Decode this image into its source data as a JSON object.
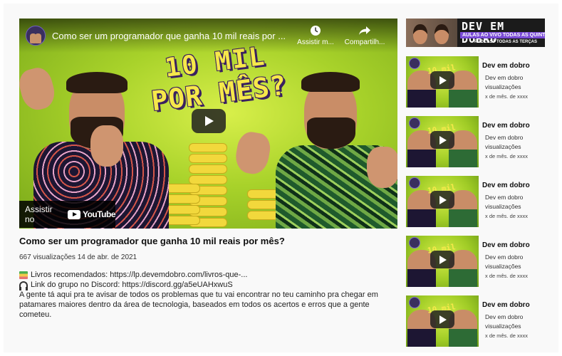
{
  "player": {
    "title": "Como ser um programador que ganha 10 mil reais por ...",
    "watch_later_label": "Assistir m...",
    "share_label": "Compartilh...",
    "thumb_text_line1": "10 MIL",
    "thumb_text_line2": "POR MÊS?",
    "watch_on_label": "Assistir no",
    "youtube_logo_text": "YouTube"
  },
  "video": {
    "title": "Como ser um programador que ganha 10 mil reais por mês?",
    "meta": "667 visualizações 14 de abr. de 2021",
    "desc_books": "Livros recomendados: https://lp.devemdobro.com/livros-que-...",
    "desc_discord": "Link do grupo no Discord: https://discord.gg/a5eUAHxwuS",
    "desc_body": "A gente tá aqui pra te avisar de todos os problemas que tu vai encontrar no teu caminho pra chegar em patamares maiores dentro da área de tecnologia, baseados em todos os acertos e erros que a gente cometeu."
  },
  "banner": {
    "line1": "DEV EM DOBRO",
    "line2": "AULAS AO VIVO TODAS AS QUINTAS",
    "line3": "PODCAST TODAS AS TERÇAS"
  },
  "related": [
    {
      "title": "Dev em dobro",
      "channel": "Dev em dobro",
      "views": "visualizações",
      "date": "x de mês. de xxxx",
      "thumb_text": "10 mil"
    },
    {
      "title": "Dev em dobro",
      "channel": "Dev em dobro",
      "views": "visualizações",
      "date": "x de mês. de xxxx",
      "thumb_text": "10 mil"
    },
    {
      "title": "Dev em dobro",
      "channel": "Dev em dobro",
      "views": "visualizações",
      "date": "x de mês. de xxxx",
      "thumb_text": "10 mil"
    },
    {
      "title": "Dev em dobro",
      "channel": "Dev em dobro",
      "views": "visualizações",
      "date": "x de mês. de xxxx",
      "thumb_text": "10 mil"
    },
    {
      "title": "Dev em dobro",
      "channel": "Dev em dobro",
      "views": "visualizações",
      "date": "x de mês. de xxxx",
      "thumb_text": "10 mil"
    }
  ]
}
